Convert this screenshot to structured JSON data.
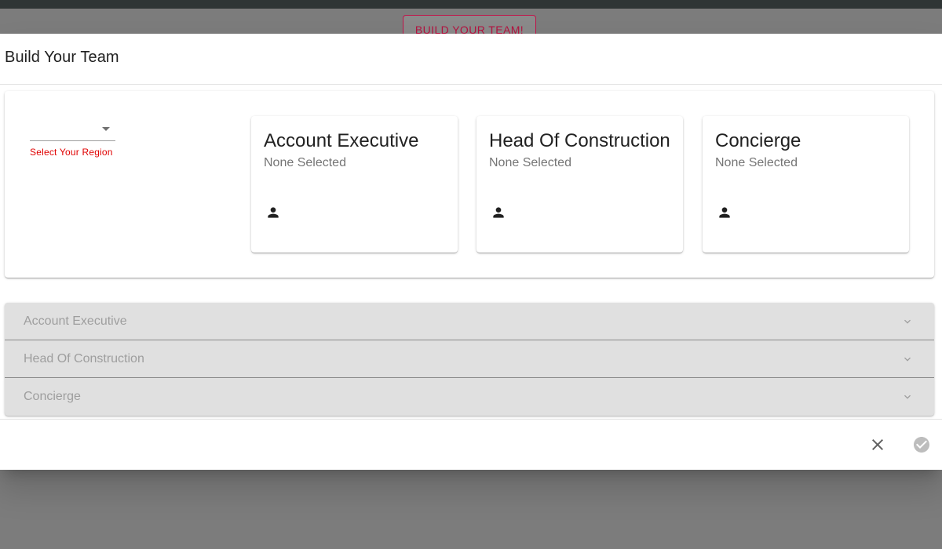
{
  "background": {
    "build_button_label": "BUILD YOUR TEAM!"
  },
  "dialog": {
    "title": "Build Your Team",
    "region": {
      "value": "",
      "helper_text": "Select Your Region"
    },
    "role_cards": [
      {
        "title": "Account Executive",
        "subtitle": "None Selected",
        "icon": "person-icon"
      },
      {
        "title": "Head Of Construction",
        "subtitle": "None Selected",
        "icon": "person-icon"
      },
      {
        "title": "Concierge",
        "subtitle": "None Selected",
        "icon": "person-icon"
      }
    ],
    "accordions": [
      {
        "label": "Account Executive",
        "icon": "chevron-down-icon"
      },
      {
        "label": "Head Of Construction",
        "icon": "chevron-down-icon"
      },
      {
        "label": "Concierge",
        "icon": "chevron-down-icon"
      }
    ],
    "actions": {
      "close_icon": "close-icon",
      "confirm_icon": "check-circle-icon"
    }
  },
  "colors": {
    "accent": "#b3123f",
    "error": "#e00000",
    "accordion_bg": "#e0e0e0"
  }
}
